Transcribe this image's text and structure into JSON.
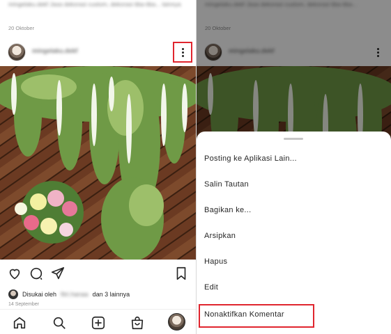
{
  "left": {
    "caption": "mingelaku.dekf Jasa dekorasi custom, dekorasi tiba-tiba... lainnya",
    "date": "20 Oktober",
    "username": "mingelaku.dekf",
    "liked_prefix": "Disukai oleh",
    "liked_name": "fitri.hanaa",
    "liked_suffix": "dan 3 lainnya",
    "post_date": "14 September"
  },
  "right": {
    "caption": "mingelaku.dekf Jasa dekorasi custom, dekorasi tiba-tiba...",
    "date": "20 Oktober",
    "username": "mingelaku.dekf",
    "menu": [
      "Posting ke Aplikasi Lain...",
      "Salin Tautan",
      "Bagikan ke...",
      "Arsipkan",
      "Hapus",
      "Edit",
      "Nonaktifkan Komentar"
    ]
  },
  "icons": {
    "actions": [
      "heart-icon",
      "comment-icon",
      "share-icon",
      "bookmark-icon"
    ],
    "nav": [
      "home-icon",
      "search-icon",
      "new-post-icon",
      "shop-icon",
      "profile-avatar"
    ]
  },
  "colors": {
    "highlight": "#e0252e",
    "text": "#262626",
    "muted": "#8e8e8e"
  }
}
